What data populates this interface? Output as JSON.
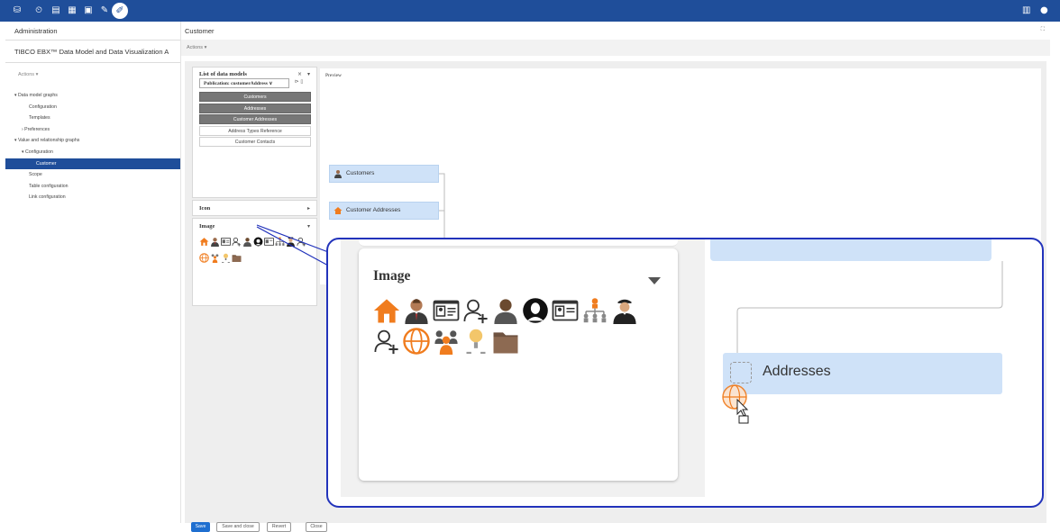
{
  "topbar": {
    "icons": [
      "database-icon",
      "clock-icon",
      "document-icon",
      "data-model-icon",
      "document-add-icon",
      "wrench-icon"
    ],
    "active_icon": "tools-icon",
    "right_icons": [
      "book-icon",
      "user-avatar-icon"
    ]
  },
  "sidebar": {
    "header": "Administration",
    "title": "TIBCO EBX™ Data Model and Data Visualization A",
    "actions": "Actions ▾",
    "tree": [
      {
        "label": "▾ Data model graphs",
        "indent": 0
      },
      {
        "label": "Configuration",
        "indent": 2
      },
      {
        "label": "Templates",
        "indent": 2
      },
      {
        "label": "› Preferences",
        "indent": 1
      },
      {
        "label": "▾ Value and relationship graphs",
        "indent": 0
      },
      {
        "label": "▾ Configuration",
        "indent": 1
      },
      {
        "label": "Customer",
        "indent": 3,
        "selected": true
      },
      {
        "label": "Scope",
        "indent": 2
      },
      {
        "label": "Table configuration",
        "indent": 2
      },
      {
        "label": "Link configuration",
        "indent": 2
      }
    ]
  },
  "content": {
    "title": "Customer",
    "expand_icon": "⛶",
    "actions": "Actions ▾",
    "data_models_panel": {
      "title": "List of data models",
      "publication": "Publication: customerAddress ∨",
      "models": [
        {
          "label": "Customers",
          "style": "dark"
        },
        {
          "label": "Addresses",
          "style": "dark"
        },
        {
          "label": "Customer Addresses",
          "style": "dark"
        },
        {
          "label": "Address Types Reference",
          "style": "light"
        },
        {
          "label": "Customer Contacts",
          "style": "light"
        }
      ]
    },
    "icon_panel": {
      "title": "Icon"
    },
    "image_panel": {
      "title": "Image"
    },
    "preview": {
      "title": "Preview",
      "nodes": [
        "Customers",
        "Customer Addresses"
      ]
    },
    "buttons": {
      "save": "Save",
      "save_close": "Save and close",
      "revert": "Revert",
      "close": "Close"
    }
  },
  "zoom": {
    "title": "Image",
    "icons": [
      "house-icon",
      "businessman-icon",
      "id-card-icon",
      "add-user-icon",
      "person-dark-icon",
      "person-circle-icon",
      "id-card-icon",
      "org-chart-icon",
      "pilot-icon",
      "add-user-icon",
      "globe-icon",
      "team-icon",
      "lightbulb-person-icon",
      "folder-icon"
    ],
    "node_label": "Addresses"
  },
  "colors": {
    "brand": "#1f4e9a",
    "node": "#cfe2f8",
    "zoom_border": "#2233bb",
    "orange": "#f07c1e"
  }
}
